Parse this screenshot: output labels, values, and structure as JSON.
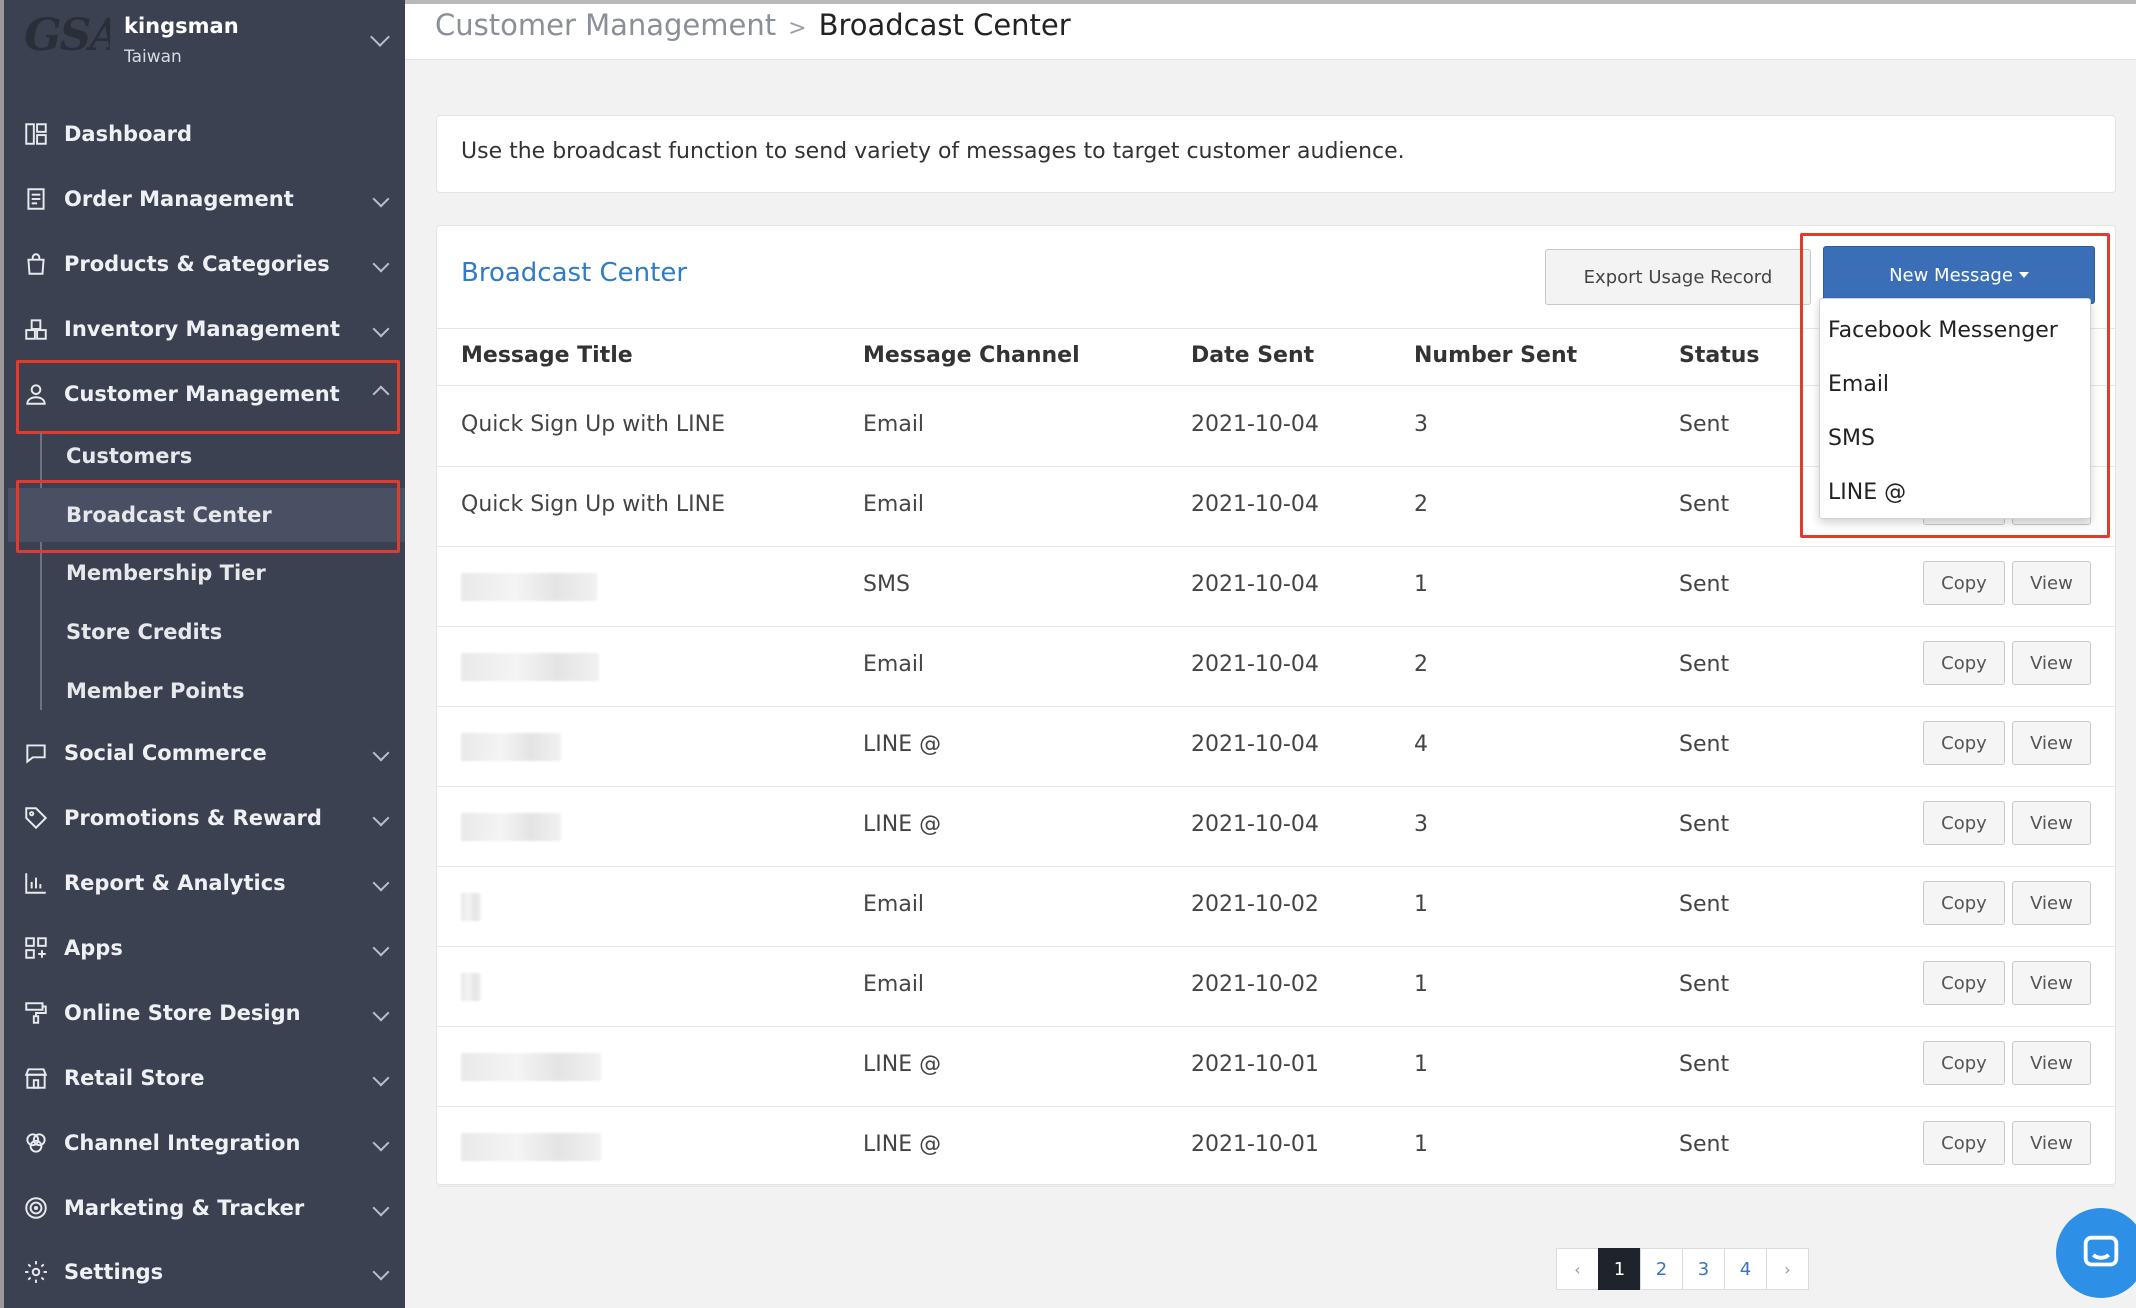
{
  "brand": {
    "logo_text": "GSA",
    "account_name": "kingsman",
    "region": "Taiwan"
  },
  "sidebar": {
    "items": [
      {
        "label": "Dashboard",
        "icon": "dashboard-icon"
      },
      {
        "label": "Order Management",
        "icon": "clipboard-icon"
      },
      {
        "label": "Products & Categories",
        "icon": "bag-icon"
      },
      {
        "label": "Inventory Management",
        "icon": "boxes-icon"
      },
      {
        "label": "Customer Management",
        "icon": "user-icon"
      },
      {
        "label": "Social Commerce",
        "icon": "chat-icon"
      },
      {
        "label": "Promotions & Reward",
        "icon": "tag-icon"
      },
      {
        "label": "Report & Analytics",
        "icon": "chart-icon"
      },
      {
        "label": "Apps",
        "icon": "apps-icon"
      },
      {
        "label": "Online Store Design",
        "icon": "paint-roller-icon"
      },
      {
        "label": "Retail Store",
        "icon": "store-icon"
      },
      {
        "label": "Channel Integration",
        "icon": "circles-icon"
      },
      {
        "label": "Marketing & Tracker",
        "icon": "target-icon"
      },
      {
        "label": "Settings",
        "icon": "gear-icon"
      }
    ],
    "sub_items": [
      {
        "label": "Customers"
      },
      {
        "label": "Broadcast Center"
      },
      {
        "label": "Membership Tier"
      },
      {
        "label": "Store Credits"
      },
      {
        "label": "Member Points"
      }
    ]
  },
  "breadcrumb": {
    "parent": "Customer Management",
    "separator": ">",
    "current": "Broadcast Center"
  },
  "info_text": "Use the broadcast function to send variety of messages to target customer audience.",
  "panel": {
    "title": "Broadcast Center",
    "export_label": "Export Usage Record",
    "new_message_label": "New Message"
  },
  "dropdown": {
    "options": [
      "Facebook Messenger",
      "Email",
      "SMS",
      "LINE @"
    ]
  },
  "table": {
    "headers": [
      "Message Title",
      "Message Channel",
      "Date Sent",
      "Number Sent",
      "Status"
    ],
    "copy_label": "Copy",
    "view_label": "View",
    "rows": [
      {
        "title": "Quick Sign Up with LINE",
        "channel": "Email",
        "date": "2021-10-04",
        "number": "3",
        "status": "Sent"
      },
      {
        "title": "Quick Sign Up with LINE",
        "channel": "Email",
        "date": "2021-10-04",
        "number": "2",
        "status": "Sent"
      },
      {
        "title": "",
        "channel": "SMS",
        "date": "2021-10-04",
        "number": "1",
        "status": "Sent"
      },
      {
        "title": "",
        "channel": "Email",
        "date": "2021-10-04",
        "number": "2",
        "status": "Sent"
      },
      {
        "title": "",
        "channel": "LINE @",
        "date": "2021-10-04",
        "number": "4",
        "status": "Sent"
      },
      {
        "title": "",
        "channel": "LINE @",
        "date": "2021-10-04",
        "number": "3",
        "status": "Sent"
      },
      {
        "title": "",
        "channel": "Email",
        "date": "2021-10-02",
        "number": "1",
        "status": "Sent"
      },
      {
        "title": "",
        "channel": "Email",
        "date": "2021-10-02",
        "number": "1",
        "status": "Sent"
      },
      {
        "title": "",
        "channel": "LINE @",
        "date": "2021-10-01",
        "number": "1",
        "status": "Sent"
      },
      {
        "title": "",
        "channel": "LINE @",
        "date": "2021-10-01",
        "number": "1",
        "status": "Sent"
      }
    ]
  },
  "pagination": {
    "prev": "‹",
    "pages": [
      "1",
      "2",
      "3",
      "4"
    ],
    "current": "1",
    "next": "›"
  },
  "colors": {
    "sidebar_bg": "#3b4151",
    "accent_blue": "#3a6fb8",
    "link_blue": "#2f7bc6",
    "highlight_red": "#e23b2e",
    "chat_blue": "#2e8fe6"
  }
}
